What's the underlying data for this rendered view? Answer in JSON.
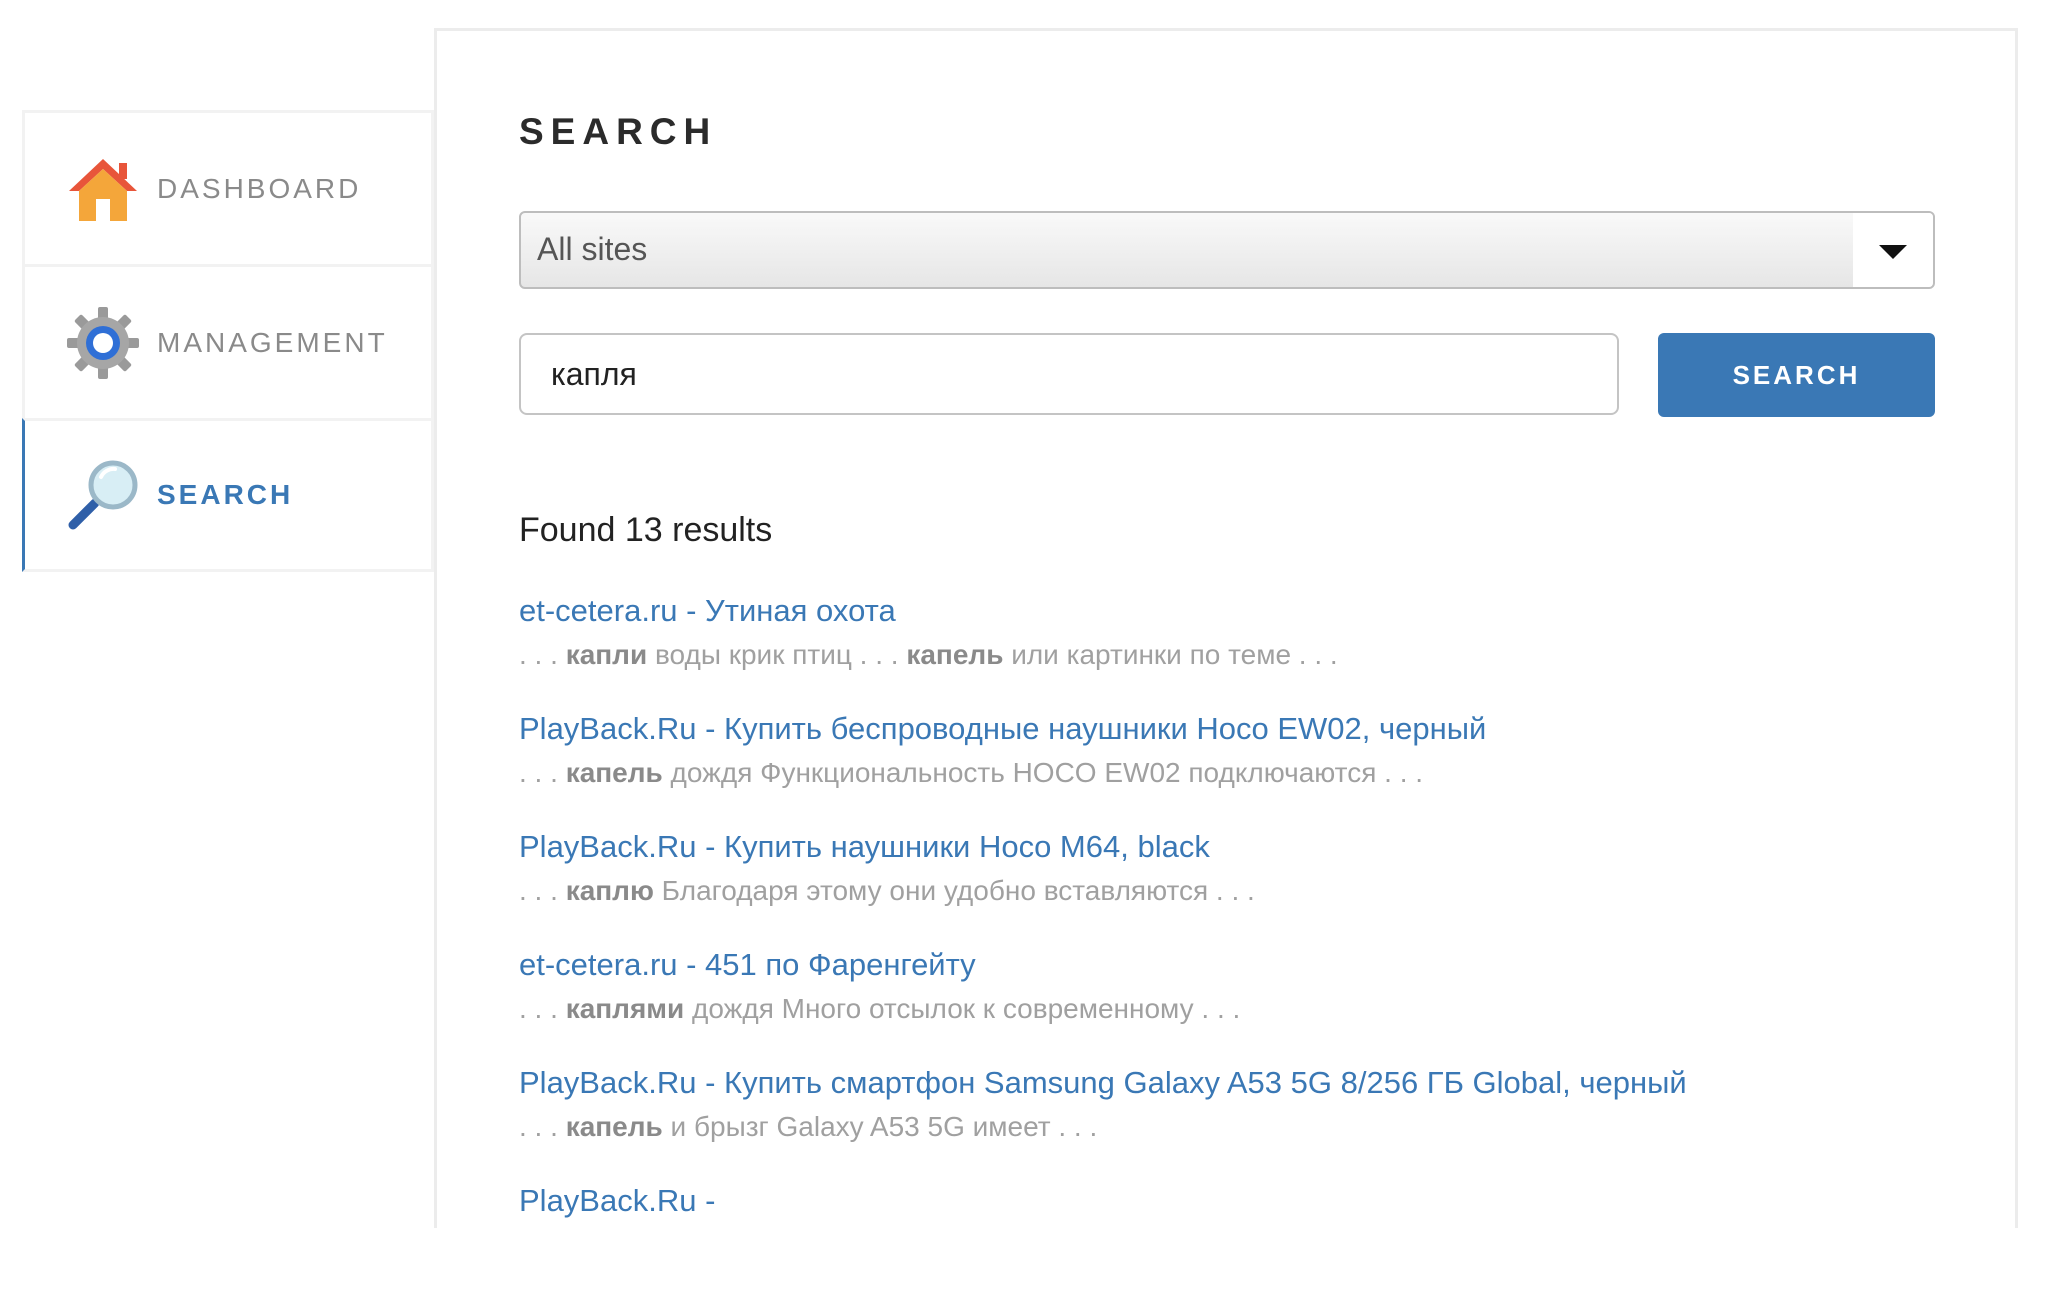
{
  "sidebar": {
    "items": [
      {
        "label": "DASHBOARD",
        "icon": "house-icon",
        "active": false
      },
      {
        "label": "MANAGEMENT",
        "icon": "gear-icon",
        "active": false
      },
      {
        "label": "SEARCH",
        "icon": "magnifier-icon",
        "active": true
      }
    ]
  },
  "main": {
    "title": "SEARCH",
    "site_select": {
      "value": "All sites"
    },
    "query": {
      "value": "капля",
      "placeholder": ""
    },
    "search_button_label": "SEARCH",
    "results_count": "Found 13 results",
    "results": [
      {
        "title": "et-cetera.ru - Утиная охота",
        "snippet_parts": [
          {
            "text": " . . . ",
            "bold": false
          },
          {
            "text": "капли",
            "bold": true
          },
          {
            "text": " воды крик птиц . . . ",
            "bold": false
          },
          {
            "text": "капель",
            "bold": true
          },
          {
            "text": " или картинки по теме . . .",
            "bold": false
          }
        ]
      },
      {
        "title": "PlayBack.Ru - Купить беспроводные наушники Hoco EW02, черный",
        "snippet_parts": [
          {
            "text": " . . . ",
            "bold": false
          },
          {
            "text": "капель",
            "bold": true
          },
          {
            "text": " дождя Функциональность HOCO EW02 подключаются . . .",
            "bold": false
          }
        ]
      },
      {
        "title": "PlayBack.Ru - Купить наушники Hoco M64, black",
        "snippet_parts": [
          {
            "text": " . . . ",
            "bold": false
          },
          {
            "text": "каплю",
            "bold": true
          },
          {
            "text": " Благодаря этому они удобно вставляются . . .",
            "bold": false
          }
        ]
      },
      {
        "title": "et-cetera.ru - 451 по Фаренгейту",
        "snippet_parts": [
          {
            "text": " . . . ",
            "bold": false
          },
          {
            "text": "каплями",
            "bold": true
          },
          {
            "text": " дождя Много отсылок к современному . . .",
            "bold": false
          }
        ]
      },
      {
        "title": "PlayBack.Ru - Купить смартфон Samsung Galaxy A53 5G 8/256 ГБ Global, черный",
        "snippet_parts": [
          {
            "text": " . . . ",
            "bold": false
          },
          {
            "text": "капель",
            "bold": true
          },
          {
            "text": " и брызг Galaxy A53 5G имеет . . .",
            "bold": false
          }
        ]
      },
      {
        "title": "PlayBack.Ru -",
        "snippet_parts": []
      }
    ]
  },
  "colors": {
    "accent": "#3a78b5",
    "snippet_text": "#a0a0a0",
    "border": "#ececec"
  }
}
